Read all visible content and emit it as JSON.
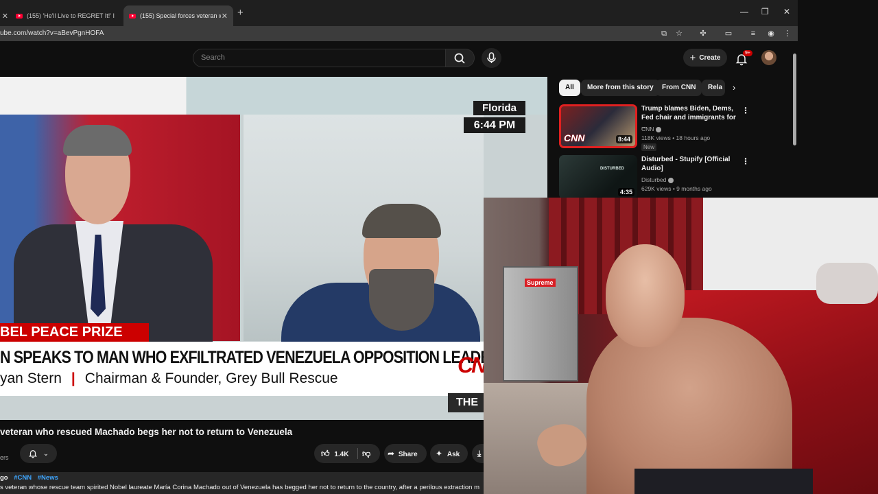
{
  "browser": {
    "tabs": [
      {
        "title": ""
      },
      {
        "title": "(155) 'He'll Live to REGRET It!' I"
      },
      {
        "title": "(155) Special forces veteran wh"
      }
    ],
    "new_tab_icon": "plus-icon",
    "url": "ube.com/watch?v=aBevPgnHOFA",
    "window_controls": [
      "minimize-icon",
      "maximize-icon",
      "close-icon"
    ]
  },
  "youtube": {
    "search_placeholder": "Search",
    "create_label": "Create",
    "notification_badge": "9+",
    "accent": "#ff0033"
  },
  "video": {
    "location": "Florida",
    "time": "6:44 PM",
    "tag": "BEL PEACE PRIZE",
    "headline": "N SPEAKS TO MAN WHO EXFILTRATED VENEZUELA OPPOSITION LEADER",
    "subline_name": "yan Stern",
    "subline_sep": "|",
    "subline_role": "Chairman & Founder, Grey Bull Rescue",
    "network": "CNN",
    "show_fragment": "THE",
    "title": "veteran who rescued Machado begs her not to return to Venezuela",
    "subscribers_fragment": "ers",
    "likes": "1.4K",
    "share_label": "Share",
    "ask_label": "Ask"
  },
  "description": {
    "time_fragment": "go",
    "tags": [
      "#CNN",
      "#News"
    ],
    "text": "s veteran whose rescue team spirited Nobel laureate María Corina Machado out of Venezuela has begged her not to return to the country, after a perilous extraction m"
  },
  "chips": [
    "All",
    "More from this story",
    "From CNN",
    "Rela"
  ],
  "recommendations": [
    {
      "title": "Trump blames Biden, Dems, Fed chair and immigrants for ...",
      "channel": "CNN",
      "meta": "118K views • 18 hours ago",
      "badge": "New",
      "duration": "8:44",
      "thumb_label": "CNN"
    },
    {
      "title": "Disturbed - Stupify [Official Audio]",
      "channel": "Disturbed",
      "meta": "629K views • 9 months ago",
      "duration": "4:35",
      "thumb_label": "DISTURBED"
    }
  ],
  "webcam": {
    "sticker": "Supreme"
  }
}
